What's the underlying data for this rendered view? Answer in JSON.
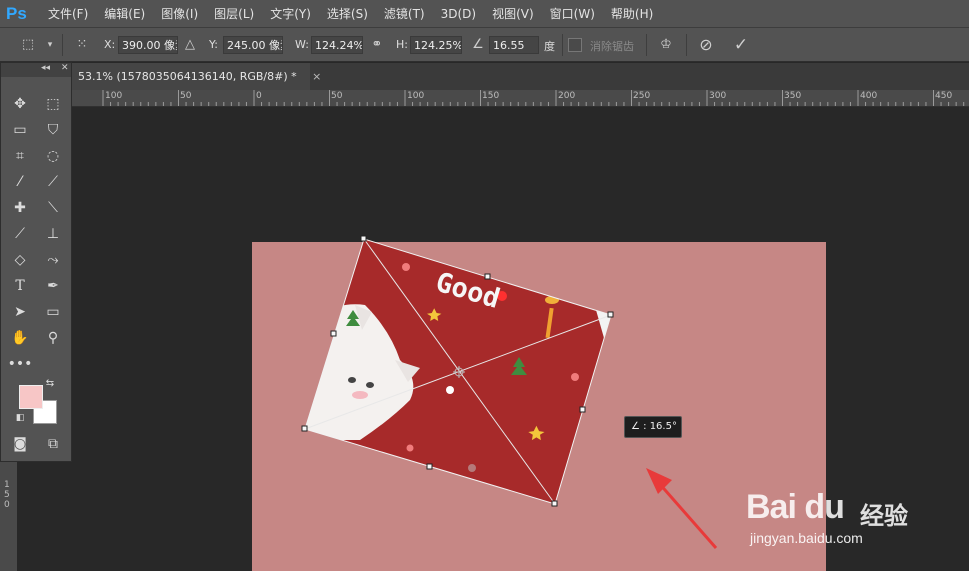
{
  "app": {
    "logo": "Ps"
  },
  "menu": [
    "文件(F)",
    "编辑(E)",
    "图像(I)",
    "图层(L)",
    "文字(Y)",
    "选择(S)",
    "滤镜(T)",
    "3D(D)",
    "视图(V)",
    "窗口(W)",
    "帮助(H)"
  ],
  "options": {
    "x_label": "X:",
    "x_value": "390.00 像素",
    "y_label": "Y:",
    "y_value": "245.00 像素",
    "w_label": "W:",
    "w_value": "124.24%",
    "h_label": "H:",
    "h_value": "124.25%",
    "angle_value": "16.55",
    "angle_unit": "度",
    "antialias_label": "消除锯齿"
  },
  "document_tab": {
    "title": "53.1% (1578035064136140, RGB/8#) *",
    "close": "×"
  },
  "ruler_h_labels": [
    "100",
    "50",
    "0",
    "50",
    "100",
    "150",
    "200",
    "250",
    "300",
    "350",
    "400",
    "450"
  ],
  "ruler_v_labels": [
    "1",
    "5",
    "0"
  ],
  "canvas_text": {
    "image_word": "Good"
  },
  "angle_tooltip": "∠ : 16.5°",
  "watermark": {
    "logo": "Bai du",
    "cn": "经验",
    "url": "jingyan.baidu.com"
  },
  "colors": {
    "panel": "#535353",
    "canvas": "#282828",
    "doc_bg": "#c68785",
    "card": "#a72a2a",
    "foreground": "#f7c6c6",
    "background": "#ffffff",
    "accent_arrow": "#e83a3a"
  }
}
